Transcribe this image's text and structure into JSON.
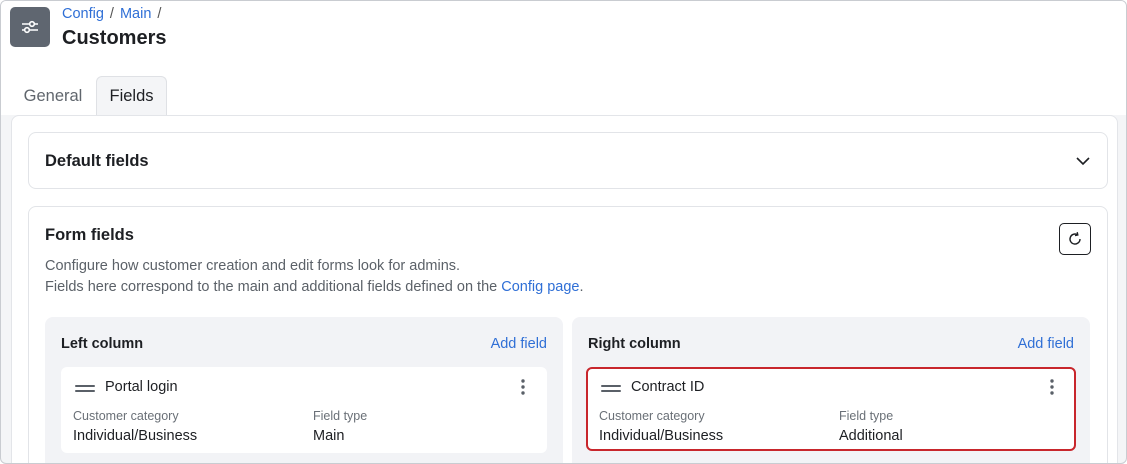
{
  "header": {
    "breadcrumb": [
      "Config",
      "Main"
    ],
    "separator": "/",
    "title": "Customers"
  },
  "tabs": [
    {
      "label": "General",
      "active": false
    },
    {
      "label": "Fields",
      "active": true
    }
  ],
  "default_fields": {
    "title": "Default fields"
  },
  "form_fields": {
    "title": "Form fields",
    "description_line1": "Configure how customer creation and edit forms look for admins.",
    "description_line2_prefix": "Fields here correspond to the main and additional fields defined on the ",
    "config_link": "Config page",
    "description_line2_suffix": ".",
    "left_column": {
      "title": "Left column",
      "add_label": "Add field",
      "fields": [
        {
          "name": "Portal login",
          "category_label": "Customer category",
          "category_value": "Individual/Business",
          "type_label": "Field type",
          "type_value": "Main"
        }
      ]
    },
    "right_column": {
      "title": "Right column",
      "add_label": "Add field",
      "fields": [
        {
          "name": "Contract ID",
          "category_label": "Customer category",
          "category_value": "Individual/Business",
          "type_label": "Field type",
          "type_value": "Additional",
          "highlighted": true
        }
      ]
    }
  },
  "colors": {
    "link": "#2f6fd6",
    "highlight_border": "#c8262c",
    "app_icon_bg": "#5f6670"
  },
  "icons": {
    "app": "sliders-icon",
    "collapse": "chevron-down-icon",
    "refresh": "refresh-icon",
    "drag": "drag-handle-icon",
    "menu": "more-vertical-icon"
  }
}
